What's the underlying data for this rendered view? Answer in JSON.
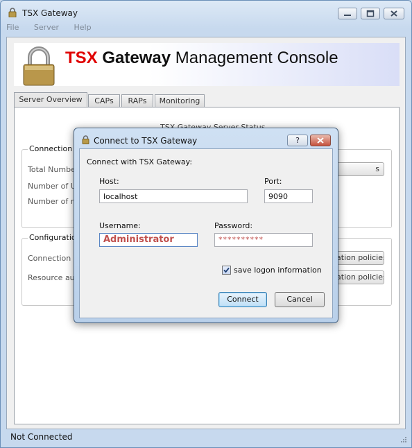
{
  "window": {
    "title": "TSX Gateway"
  },
  "menu": [
    "File",
    "Server",
    "Help"
  ],
  "banner": {
    "part1": "TSX",
    "part2": "Gateway",
    "part3": "Management Console"
  },
  "tabs": [
    "Server Overview",
    "CAPs",
    "RAPs",
    "Monitoring"
  ],
  "panel": {
    "status_title": "TSX Gateway Server Status",
    "connection_group": {
      "title": "Connection Sta",
      "rows": [
        "Total Number c",
        "Number of Use",
        "Number of res"
      ],
      "button_fragment": "s"
    },
    "config_group": {
      "title": "Configuration",
      "rows": [
        "Connection au",
        "Resource auth"
      ],
      "buttons": [
        "ation policies",
        "ation policies"
      ]
    }
  },
  "statusbar": {
    "text": "Not Connected"
  },
  "dialog": {
    "title": "Connect to TSX Gateway",
    "help_label": "?",
    "instruction": "Connect with TSX Gateway:",
    "host_label": "Host:",
    "host_value": "localhost",
    "port_label": "Port:",
    "port_value": "9090",
    "username_label": "Username:",
    "username_value": "Administrator",
    "password_label": "Password:",
    "password_value": "**********",
    "save_logon_label": "save logon information",
    "save_logon_checked": true,
    "connect_label": "Connect",
    "cancel_label": "Cancel"
  }
}
